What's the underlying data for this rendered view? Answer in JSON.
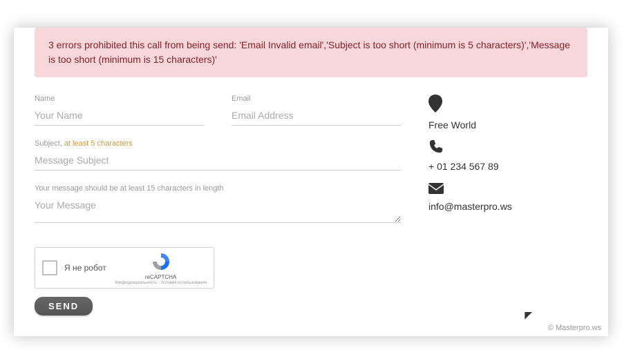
{
  "alert": "3 errors prohibited this call from being send: 'Email Invalid email','Subject is too short (minimum is 5 characters)','Message is too short (minimum is 15 characters)'",
  "form": {
    "name": {
      "label": "Name",
      "placeholder": "Your Name"
    },
    "email": {
      "label": "Email",
      "placeholder": "Email Address"
    },
    "subject": {
      "label": "Subject, ",
      "error": "at least 5 characters",
      "placeholder": "Message Subject"
    },
    "message": {
      "label": "Your message should be at least 15 characters in length",
      "placeholder": "Your Message"
    },
    "send": "SEND"
  },
  "captcha": {
    "label": "Я не робот",
    "brand": "reCAPTCHA",
    "terms": "Конфиденциальность - Условия использования"
  },
  "contact": {
    "location": "Free World",
    "phone": "+ 01 234 567 89",
    "email": "info@masterpro.ws"
  },
  "watermark": "© Masterpro.ws"
}
